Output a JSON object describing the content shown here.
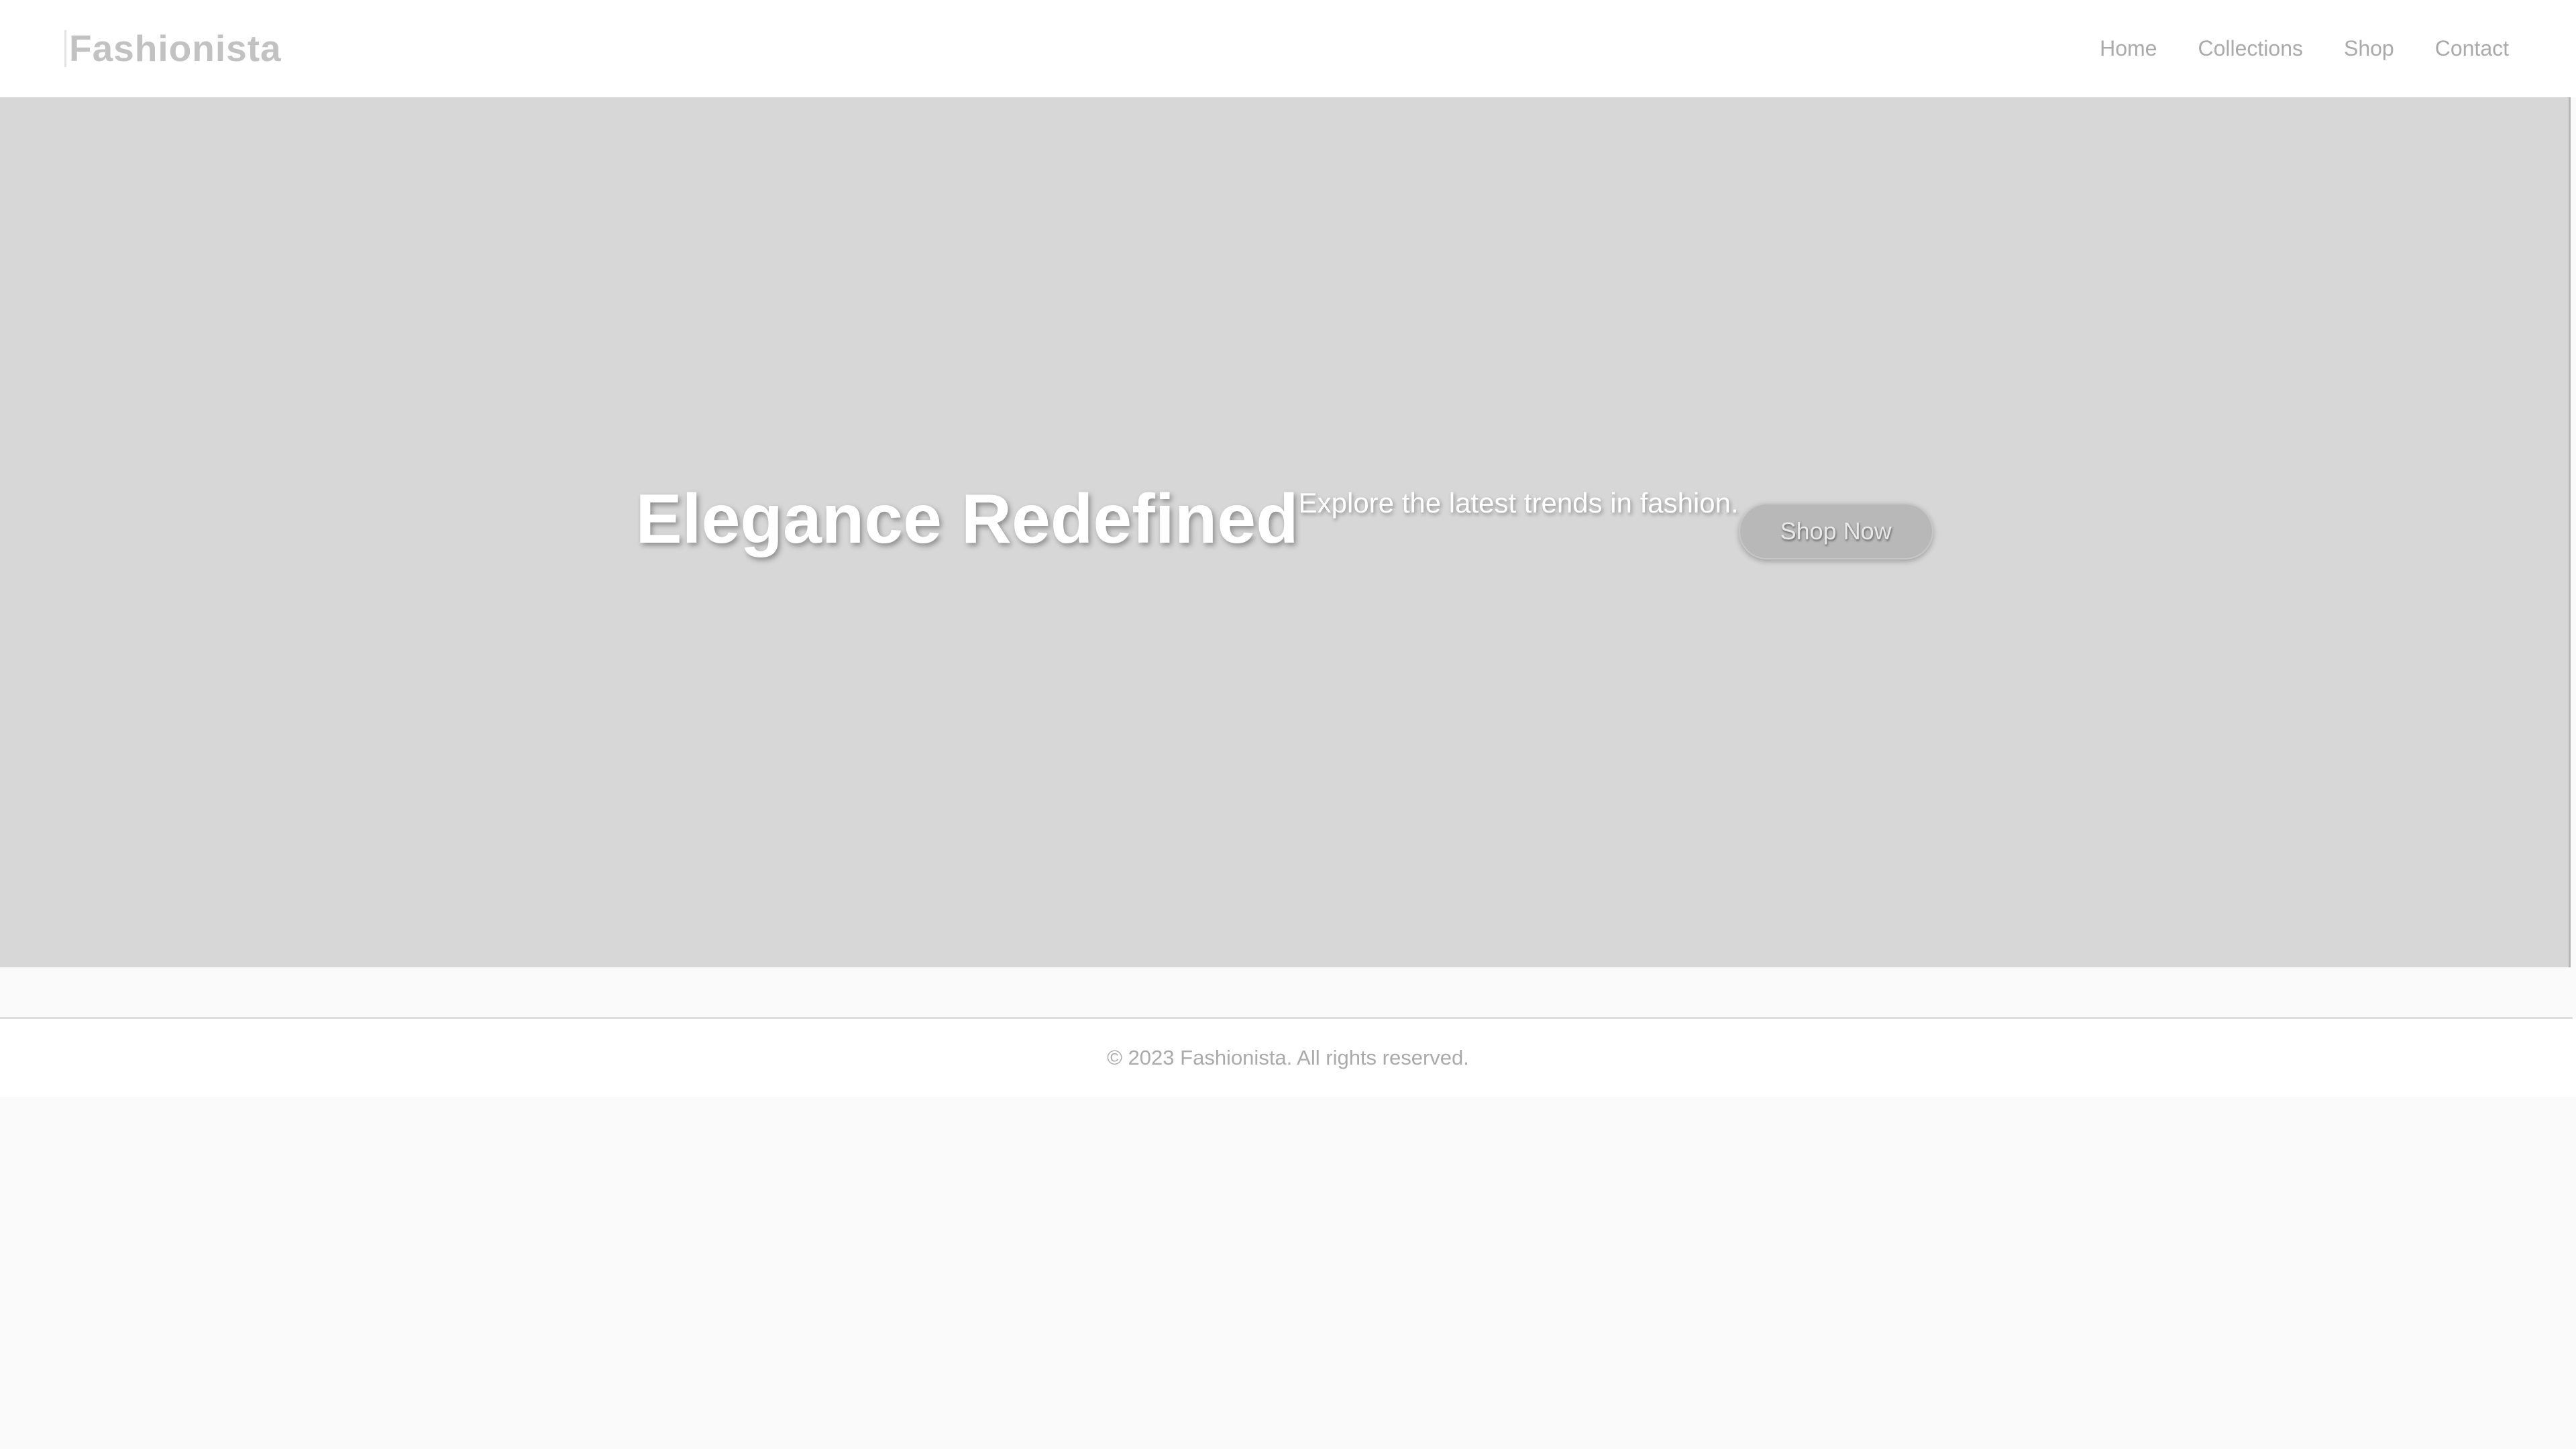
{
  "header": {
    "logo": "Fashionista",
    "nav": [
      {
        "label": "Home"
      },
      {
        "label": "Collections"
      },
      {
        "label": "Shop"
      },
      {
        "label": "Contact"
      }
    ]
  },
  "hero": {
    "title": "Elegance Redefined",
    "subtitle": "Explore the latest trends in fashion.",
    "cta_label": "Shop Now"
  },
  "footer": {
    "copyright": "© 2023 Fashionista. All rights reserved."
  },
  "colors": {
    "page_background": "#fafafa",
    "header_background": "#ffffff",
    "hero_background": "#d7d7d7",
    "logo_text": "#c2c2c2",
    "nav_text": "#aaaaaa",
    "hero_text": "#ffffff",
    "button_background": "#b8b8b8"
  }
}
